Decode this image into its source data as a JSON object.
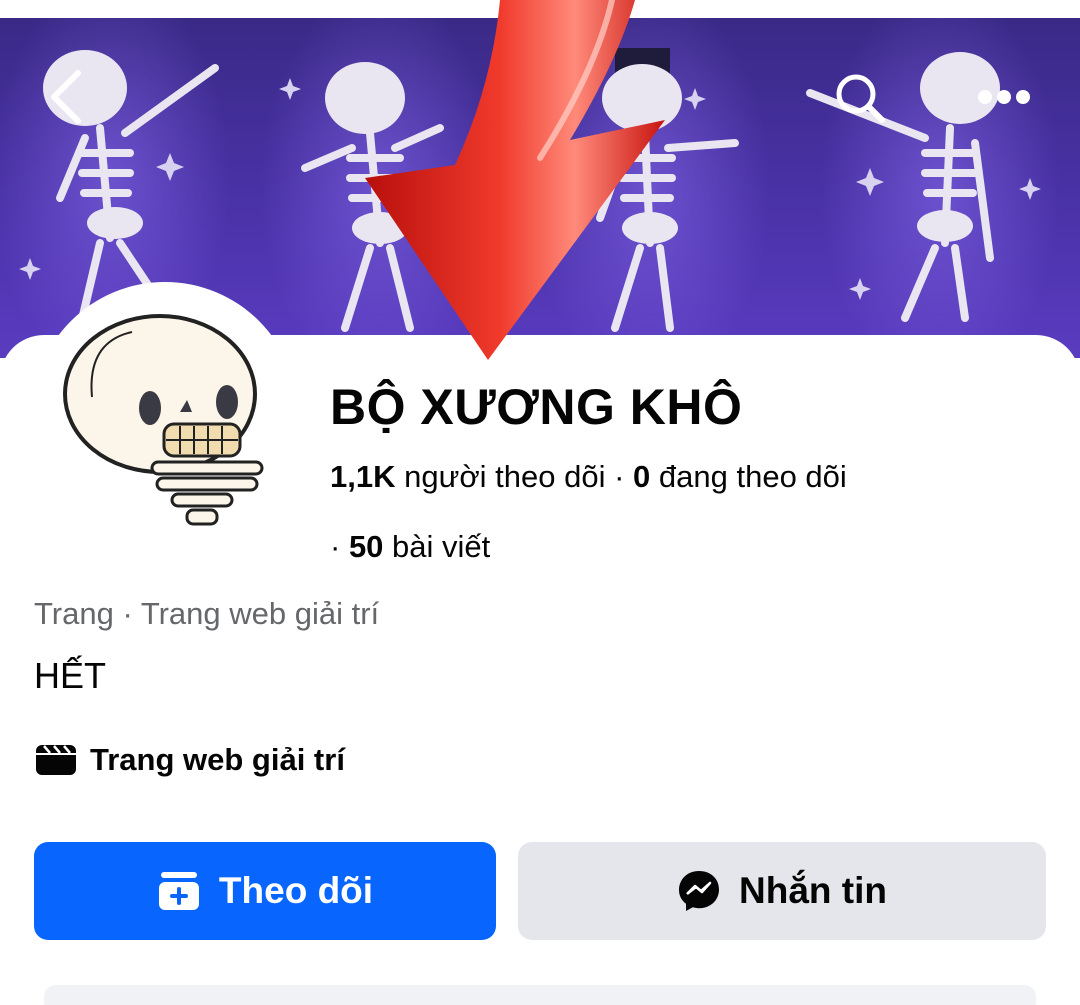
{
  "header": {
    "back_icon": "chevron-left-icon",
    "search_icon": "search-icon",
    "more_icon": "more-dots-icon"
  },
  "profile": {
    "name": "BỘ XƯƠNG KHÔ",
    "followers_count": "1,1K",
    "followers_label": " người theo dõi",
    "separator": " · ",
    "following_count": "0",
    "following_label": " đang theo dõi",
    "posts_prefix": "· ",
    "posts_count": "50",
    "posts_label": " bài viết",
    "category_line": "Trang · Trang web giải trí",
    "bio": "HẾT",
    "intro_item": "Trang web giải trí"
  },
  "actions": {
    "follow_label": "Theo dõi",
    "message_label": "Nhắn tin"
  },
  "colors": {
    "primary_button": "#0866ff",
    "secondary_button": "#e4e6eb",
    "cover_purple": "#4a32a8",
    "annotation_arrow": "#e0201a"
  }
}
